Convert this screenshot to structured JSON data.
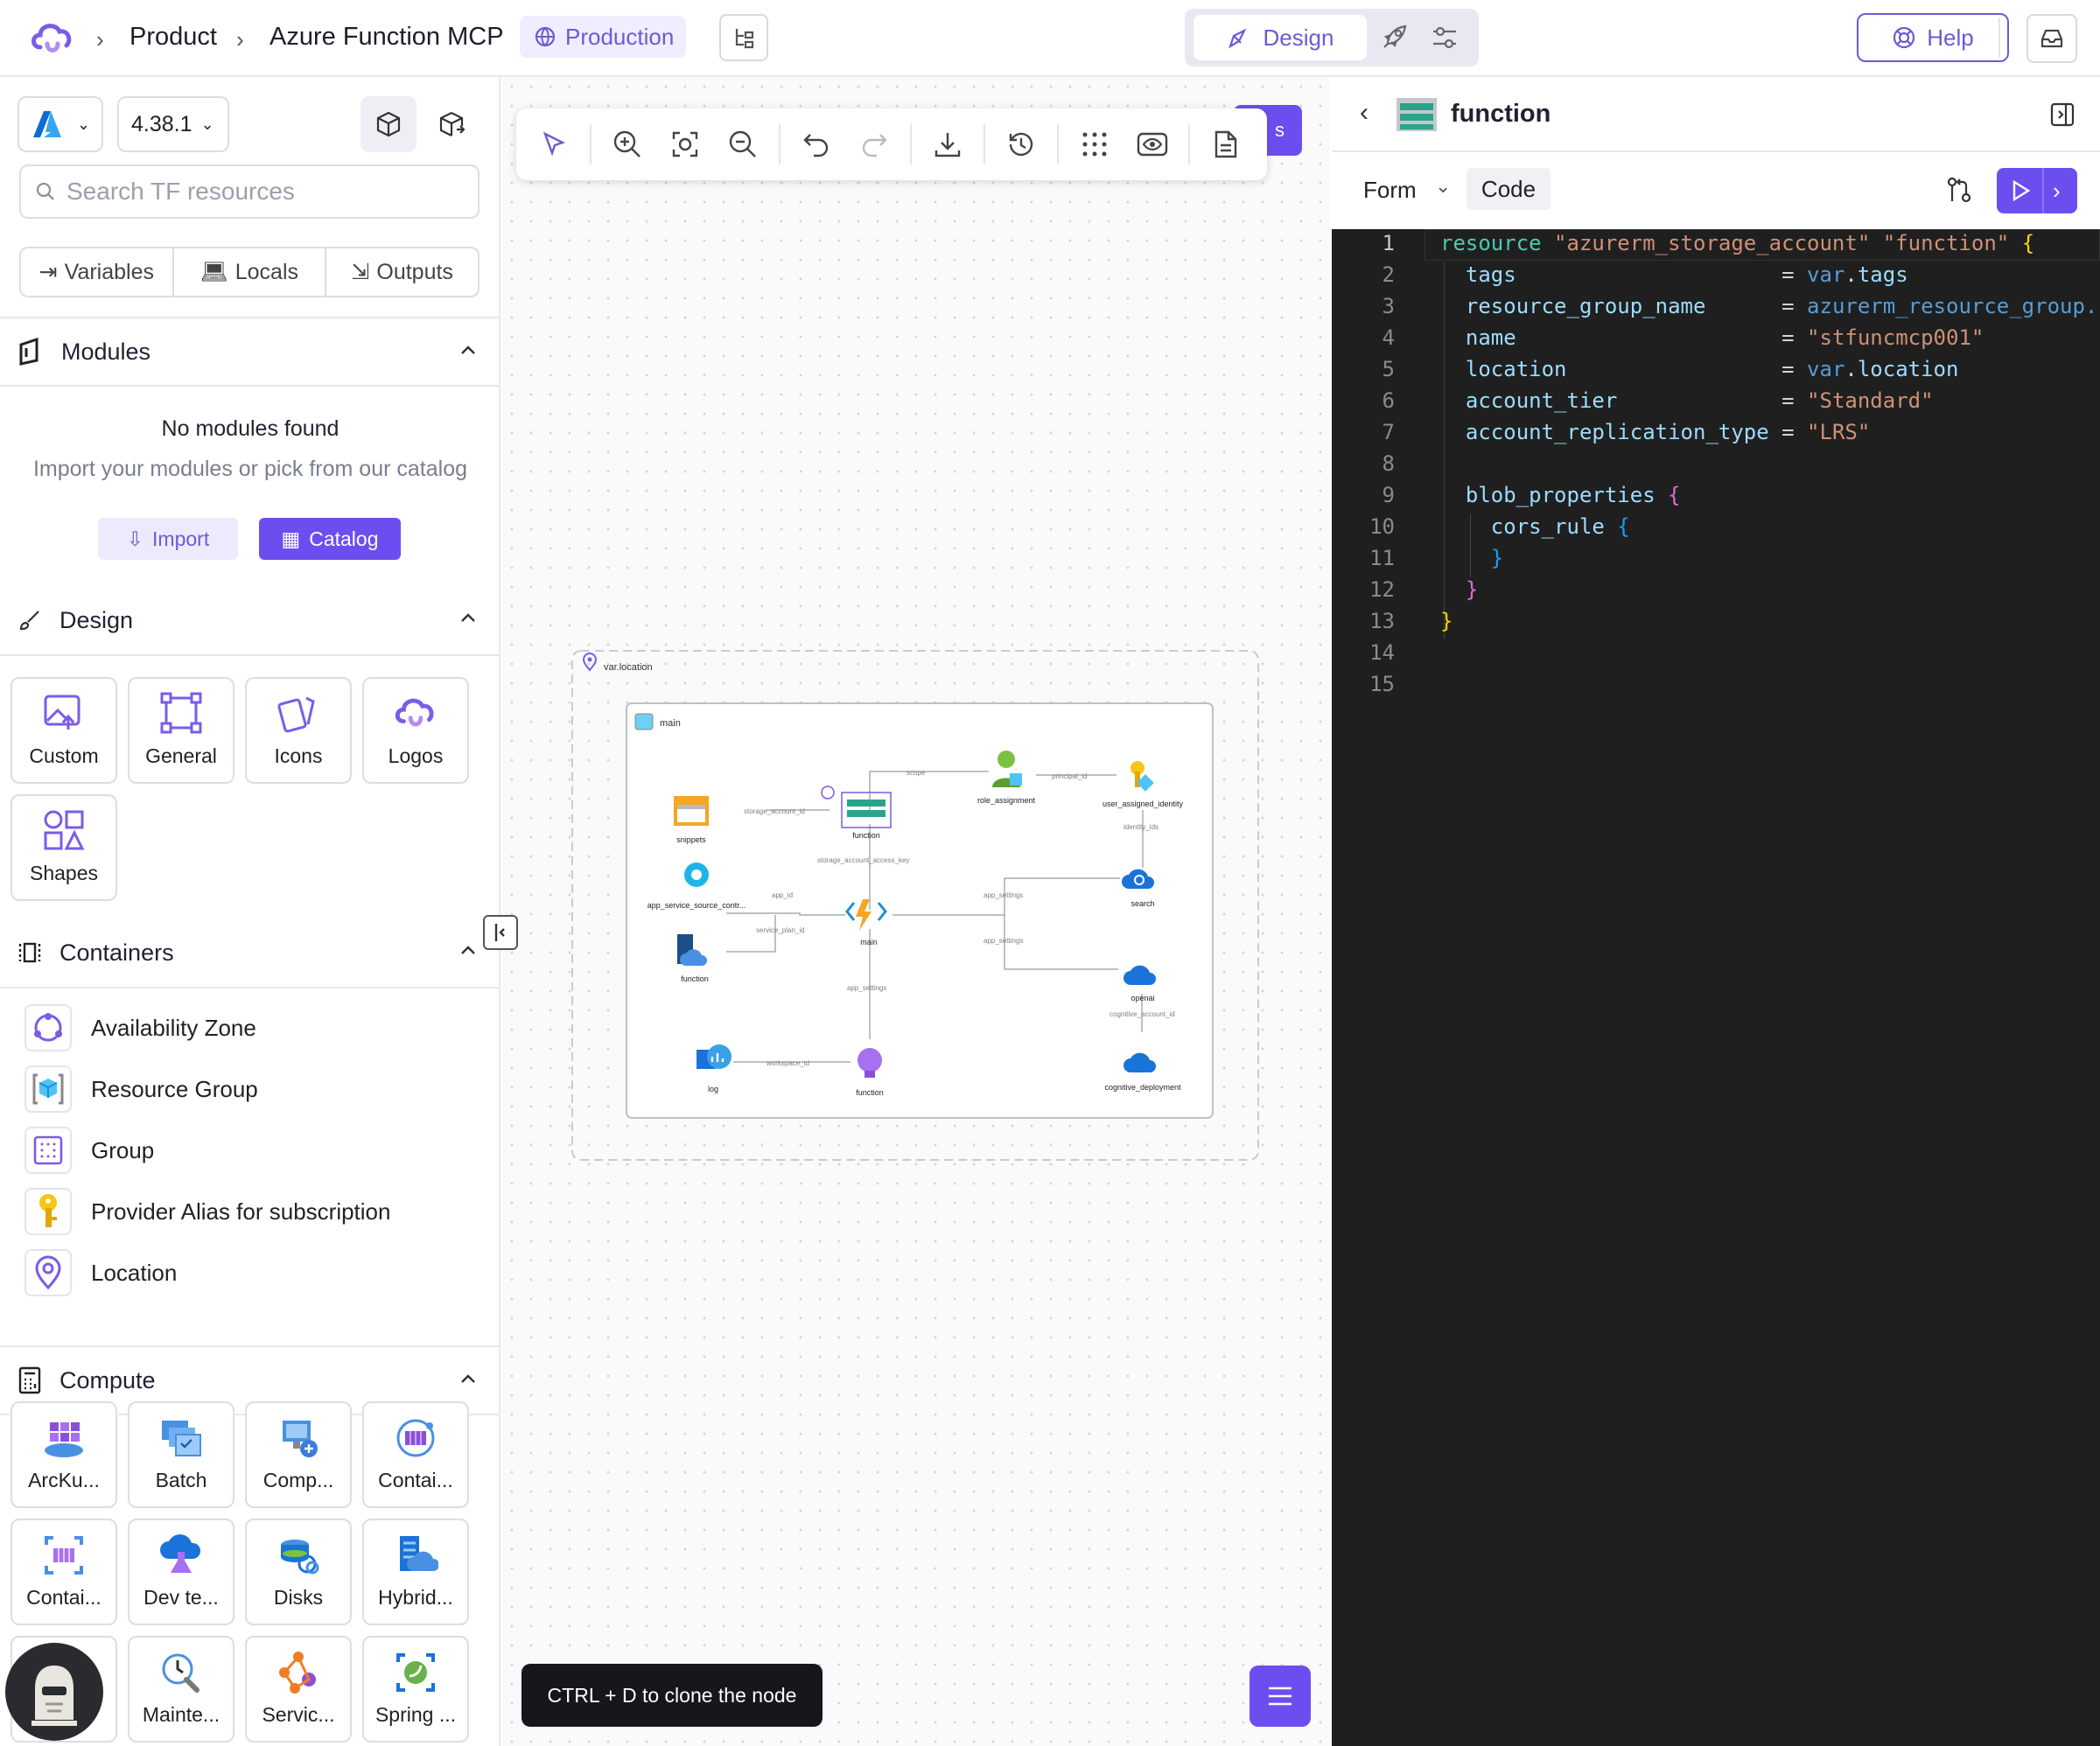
{
  "header": {
    "breadcrumb": [
      "Product",
      "Azure Function MCP"
    ],
    "env_badge": "Production",
    "mode_label": "Design",
    "help_label": "Help"
  },
  "sidebar": {
    "provider_version": "4.38.1",
    "search_placeholder": "Search TF resources",
    "tabs": [
      "Variables",
      "Locals",
      "Outputs"
    ],
    "modules": {
      "title": "Modules",
      "empty_title": "No modules found",
      "empty_text": "Import your modules or pick from our catalog",
      "import_label": "Import",
      "catalog_label": "Catalog"
    },
    "design": {
      "title": "Design",
      "tiles": [
        "Custom",
        "General",
        "Icons",
        "Logos",
        "Shapes"
      ]
    },
    "containers": {
      "title": "Containers",
      "items": [
        "Availability Zone",
        "Resource Group",
        "Group",
        "Provider Alias for subscription",
        "Location"
      ]
    },
    "compute": {
      "title": "Compute",
      "tiles": [
        "ArcKu...",
        "Batch",
        "Comp...",
        "Contai...",
        "Contai...",
        "Dev te...",
        "Disks",
        "Hybrid...",
        "",
        "Mainte...",
        "Servic...",
        "Spring ..."
      ]
    }
  },
  "canvas": {
    "tooltip": "CTRL + D to clone the node",
    "diagram": {
      "outer_label": "var.location",
      "inner_label": "main",
      "nodes": [
        "snippets",
        "function",
        "role_assignment",
        "user_assigned_identity",
        "app_service_source_contr...",
        "main",
        "search",
        "function",
        "openai",
        "log",
        "function",
        "cognitive_deployment"
      ],
      "edge_labels": [
        "scope",
        "principal_id",
        "storage_account_id",
        "identity_ids",
        "storage_account_access_key",
        "app_id",
        "app_settings",
        "service_plan_id",
        "app_settings",
        "app_settings",
        "cognitive_account_id",
        "workspace_id"
      ]
    }
  },
  "panel": {
    "title": "function",
    "form_label": "Form",
    "code_label": "Code",
    "code_lines": [
      "resource \"azurerm_storage_account\" \"function\" {",
      "  tags                     = var.tags",
      "  resource_group_name      = azurerm_resource_group.",
      "  name                     = \"stfuncmcp001\"",
      "  location                 = var.location",
      "  account_tier             = \"Standard\"",
      "  account_replication_type = \"LRS\"",
      "",
      "  blob_properties {",
      "    cors_rule {",
      "    }",
      "  }",
      "}",
      "",
      ""
    ]
  }
}
